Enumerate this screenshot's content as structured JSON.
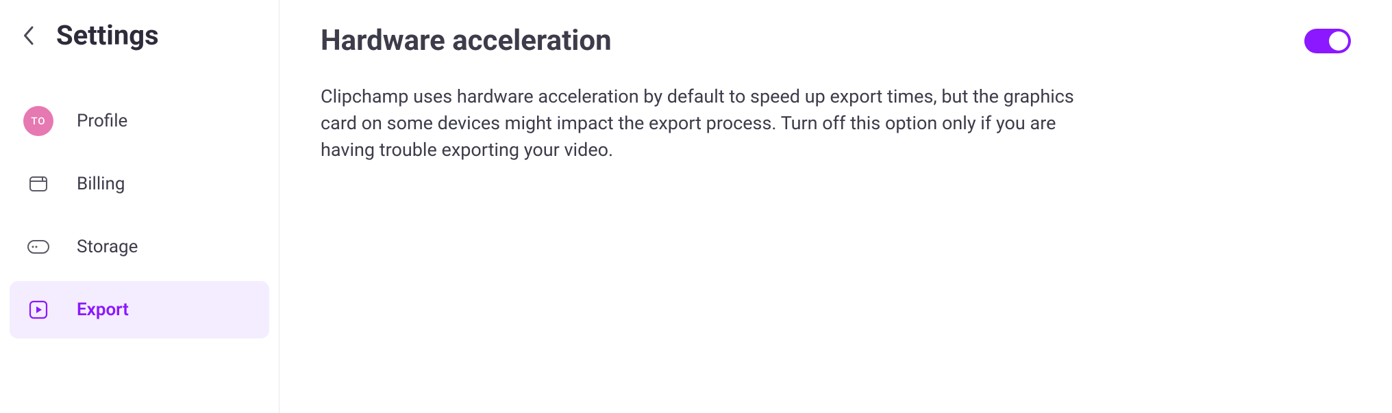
{
  "sidebar": {
    "title": "Settings",
    "avatar_initials": "TO",
    "items": [
      {
        "label": "Profile"
      },
      {
        "label": "Billing"
      },
      {
        "label": "Storage"
      },
      {
        "label": "Export"
      }
    ]
  },
  "main": {
    "title": "Hardware acceleration",
    "description": "Clipchamp uses hardware acceleration by default to speed up export times, but the graphics card on some devices might impact the export process. Turn off this option only if you are having trouble exporting your video.",
    "toggle_on": true
  },
  "colors": {
    "accent": "#8b18ff",
    "active_bg": "#f4edff",
    "avatar": "#e679b1"
  }
}
